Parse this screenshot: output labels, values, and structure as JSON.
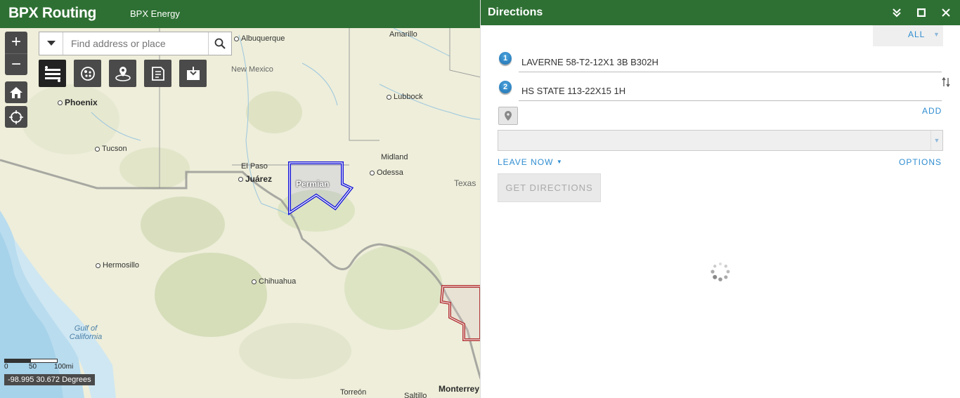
{
  "header": {
    "app_title": "BPX Routing",
    "app_subtitle": "BPX Energy"
  },
  "map": {
    "search_placeholder": "Find address or place",
    "zoom_in": "+",
    "zoom_out": "−",
    "scale_labels": [
      "0",
      "50",
      "100mi"
    ],
    "coordinates": "-98.995 30.672 Degrees",
    "places": {
      "albuquerque": "Albuquerque",
      "amarillo": "Amarillo",
      "new_mexico": "New Mexico",
      "lubbock": "Lubbock",
      "phoenix": "Phoenix",
      "tucson": "Tucson",
      "midland": "Midland",
      "odessa": "Odessa",
      "el_paso": "El Paso",
      "juarez": "Juárez",
      "texas": "Texas",
      "hermosillo": "Hermosillo",
      "chihuahua": "Chihuahua",
      "gulf_of_california": "Gulf of California",
      "torreon": "Torreón",
      "saltillo": "Saltillo",
      "monterrey": "Monterrey"
    },
    "polygons": {
      "permian": "Permian"
    }
  },
  "directions": {
    "title": "Directions",
    "all_label": "ALL",
    "stops": [
      {
        "number": "1",
        "value": "LAVERNE 58-T2-12X1 3B B302H"
      },
      {
        "number": "2",
        "value": "HS STATE 113-22X15 1H"
      }
    ],
    "add_label": "ADD",
    "leave_now_label": "LEAVE NOW",
    "options_label": "OPTIONS",
    "get_directions_label": "GET DIRECTIONS"
  }
}
